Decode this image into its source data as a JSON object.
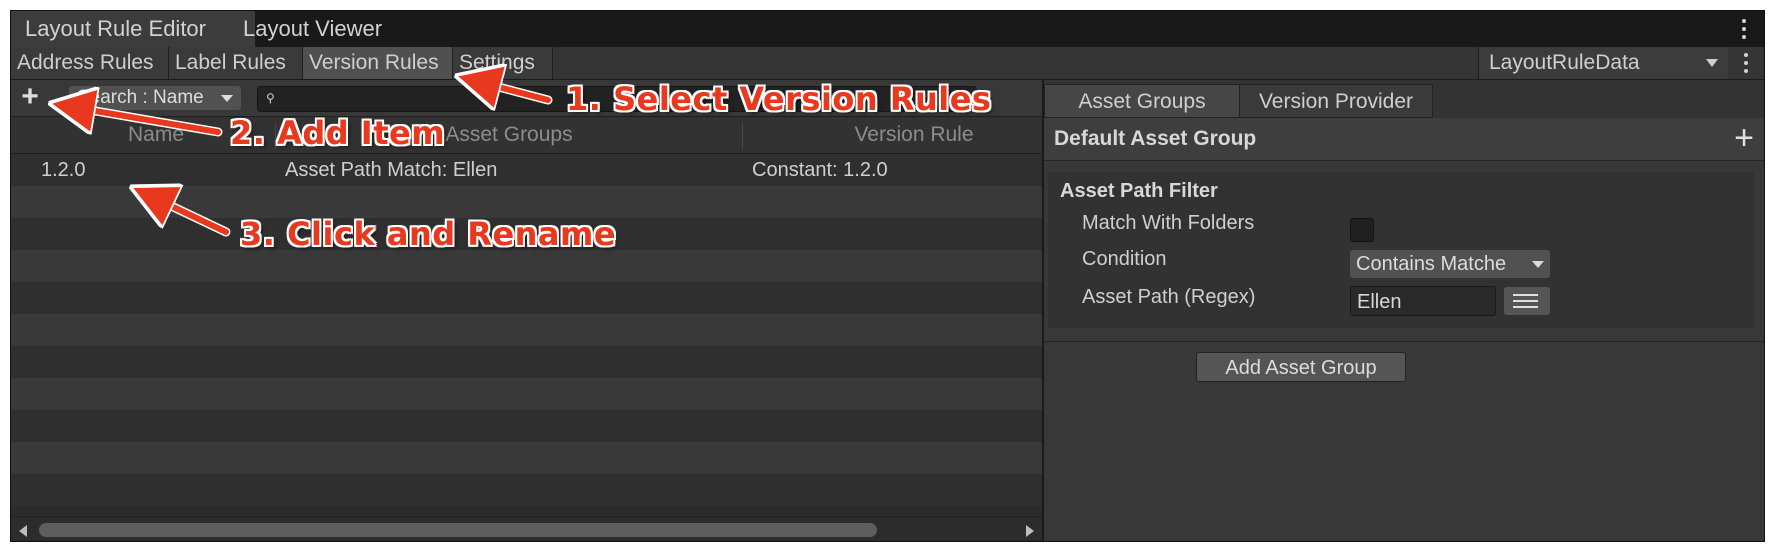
{
  "window_tabs": [
    "Layout Rule Editor",
    "Layout Viewer"
  ],
  "sub_tabs": [
    "Address Rules",
    "Label Rules",
    "Version Rules",
    "Settings"
  ],
  "data_dropdown": "LayoutRuleData",
  "left_panel": {
    "search_mode": "Search : Name",
    "search_value": "",
    "columns": [
      "Name",
      "Asset Groups",
      "Version Rule"
    ],
    "rows": [
      {
        "name": "1.2.0",
        "asset_groups": "Asset Path Match: Ellen",
        "version_rule": "Constant: 1.2.0"
      }
    ]
  },
  "right_panel": {
    "tabs": [
      "Asset Groups",
      "Version Provider"
    ],
    "group_title": "Default Asset Group",
    "filter": {
      "title": "Asset Path Filter",
      "match_with_folders_label": "Match With Folders",
      "match_with_folders": false,
      "condition_label": "Condition",
      "condition_value": "Contains Matche",
      "asset_path_label": "Asset Path (Regex)",
      "asset_path_value": "Ellen"
    },
    "add_button": "Add Asset Group"
  },
  "annotations": {
    "step1": "1. Select Version Rules",
    "step2": "2. Add Item",
    "step3": "3. Click and Rename",
    "color": "#e8381e"
  },
  "colors": {
    "background": "#282828",
    "active_tab": "#505050",
    "text": "#cfcfcf"
  }
}
